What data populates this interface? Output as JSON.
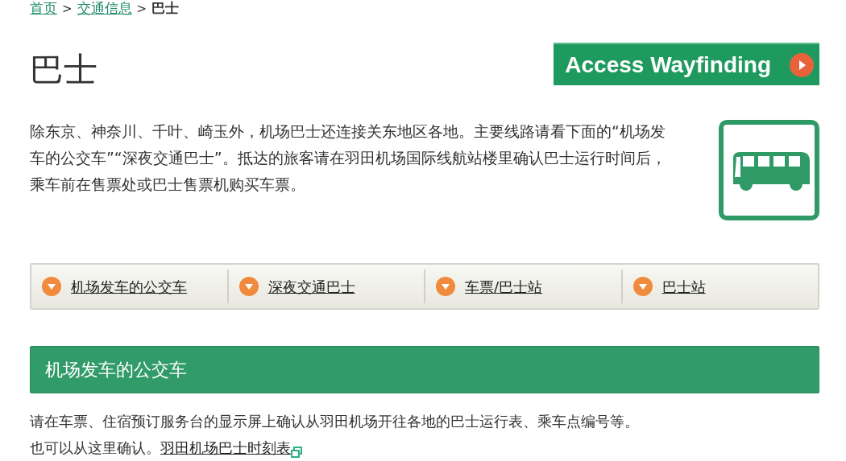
{
  "breadcrumb": [
    {
      "label": "首页",
      "link": true
    },
    {
      "label": "交通信息",
      "link": true
    },
    {
      "label": "巴士",
      "link": false
    }
  ],
  "breadcrumb_separator": ">",
  "title": "巴士",
  "banner": {
    "label": "Access Wayfinding"
  },
  "intro": "除东京、神奈川、千叶、崎玉外，机场巴士还连接关东地区各地。主要线路请看下面的“机场发车的公交车”“深夜交通巴士”。抵达的旅客请在羽田机场国际线航站楼里确认巴士运行时间后，乘车前在售票处或巴士售票机购买车票。",
  "nav": [
    "机场发车的公交车",
    "深夜交通巴士",
    "车票/巴士站",
    "巴士站"
  ],
  "section": {
    "heading": "机场发车的公交车",
    "lines": [
      "请在车票、住宿预订服务台的显示屏上确认从羽田机场开往各地的巴士运行表、乘车点编号等。"
    ],
    "lead": "也可以从这里确认。",
    "link": "羽田机场巴士时刻表"
  }
}
